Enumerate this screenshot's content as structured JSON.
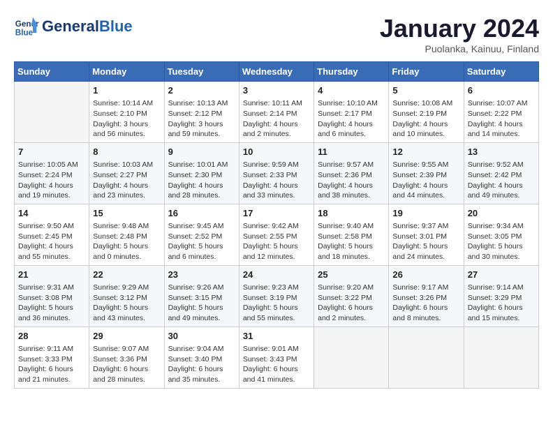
{
  "header": {
    "logo_line1": "General",
    "logo_line2": "Blue",
    "month_title": "January 2024",
    "subtitle": "Puolanka, Kainuu, Finland"
  },
  "weekdays": [
    "Sunday",
    "Monday",
    "Tuesday",
    "Wednesday",
    "Thursday",
    "Friday",
    "Saturday"
  ],
  "weeks": [
    [
      {
        "day": "",
        "info": ""
      },
      {
        "day": "1",
        "info": "Sunrise: 10:14 AM\nSunset: 2:10 PM\nDaylight: 3 hours\nand 56 minutes."
      },
      {
        "day": "2",
        "info": "Sunrise: 10:13 AM\nSunset: 2:12 PM\nDaylight: 3 hours\nand 59 minutes."
      },
      {
        "day": "3",
        "info": "Sunrise: 10:11 AM\nSunset: 2:14 PM\nDaylight: 4 hours\nand 2 minutes."
      },
      {
        "day": "4",
        "info": "Sunrise: 10:10 AM\nSunset: 2:17 PM\nDaylight: 4 hours\nand 6 minutes."
      },
      {
        "day": "5",
        "info": "Sunrise: 10:08 AM\nSunset: 2:19 PM\nDaylight: 4 hours\nand 10 minutes."
      },
      {
        "day": "6",
        "info": "Sunrise: 10:07 AM\nSunset: 2:22 PM\nDaylight: 4 hours\nand 14 minutes."
      }
    ],
    [
      {
        "day": "7",
        "info": "Sunrise: 10:05 AM\nSunset: 2:24 PM\nDaylight: 4 hours\nand 19 minutes."
      },
      {
        "day": "8",
        "info": "Sunrise: 10:03 AM\nSunset: 2:27 PM\nDaylight: 4 hours\nand 23 minutes."
      },
      {
        "day": "9",
        "info": "Sunrise: 10:01 AM\nSunset: 2:30 PM\nDaylight: 4 hours\nand 28 minutes."
      },
      {
        "day": "10",
        "info": "Sunrise: 9:59 AM\nSunset: 2:33 PM\nDaylight: 4 hours\nand 33 minutes."
      },
      {
        "day": "11",
        "info": "Sunrise: 9:57 AM\nSunset: 2:36 PM\nDaylight: 4 hours\nand 38 minutes."
      },
      {
        "day": "12",
        "info": "Sunrise: 9:55 AM\nSunset: 2:39 PM\nDaylight: 4 hours\nand 44 minutes."
      },
      {
        "day": "13",
        "info": "Sunrise: 9:52 AM\nSunset: 2:42 PM\nDaylight: 4 hours\nand 49 minutes."
      }
    ],
    [
      {
        "day": "14",
        "info": "Sunrise: 9:50 AM\nSunset: 2:45 PM\nDaylight: 4 hours\nand 55 minutes."
      },
      {
        "day": "15",
        "info": "Sunrise: 9:48 AM\nSunset: 2:48 PM\nDaylight: 5 hours\nand 0 minutes."
      },
      {
        "day": "16",
        "info": "Sunrise: 9:45 AM\nSunset: 2:52 PM\nDaylight: 5 hours\nand 6 minutes."
      },
      {
        "day": "17",
        "info": "Sunrise: 9:42 AM\nSunset: 2:55 PM\nDaylight: 5 hours\nand 12 minutes."
      },
      {
        "day": "18",
        "info": "Sunrise: 9:40 AM\nSunset: 2:58 PM\nDaylight: 5 hours\nand 18 minutes."
      },
      {
        "day": "19",
        "info": "Sunrise: 9:37 AM\nSunset: 3:01 PM\nDaylight: 5 hours\nand 24 minutes."
      },
      {
        "day": "20",
        "info": "Sunrise: 9:34 AM\nSunset: 3:05 PM\nDaylight: 5 hours\nand 30 minutes."
      }
    ],
    [
      {
        "day": "21",
        "info": "Sunrise: 9:31 AM\nSunset: 3:08 PM\nDaylight: 5 hours\nand 36 minutes."
      },
      {
        "day": "22",
        "info": "Sunrise: 9:29 AM\nSunset: 3:12 PM\nDaylight: 5 hours\nand 43 minutes."
      },
      {
        "day": "23",
        "info": "Sunrise: 9:26 AM\nSunset: 3:15 PM\nDaylight: 5 hours\nand 49 minutes."
      },
      {
        "day": "24",
        "info": "Sunrise: 9:23 AM\nSunset: 3:19 PM\nDaylight: 5 hours\nand 55 minutes."
      },
      {
        "day": "25",
        "info": "Sunrise: 9:20 AM\nSunset: 3:22 PM\nDaylight: 6 hours\nand 2 minutes."
      },
      {
        "day": "26",
        "info": "Sunrise: 9:17 AM\nSunset: 3:26 PM\nDaylight: 6 hours\nand 8 minutes."
      },
      {
        "day": "27",
        "info": "Sunrise: 9:14 AM\nSunset: 3:29 PM\nDaylight: 6 hours\nand 15 minutes."
      }
    ],
    [
      {
        "day": "28",
        "info": "Sunrise: 9:11 AM\nSunset: 3:33 PM\nDaylight: 6 hours\nand 21 minutes."
      },
      {
        "day": "29",
        "info": "Sunrise: 9:07 AM\nSunset: 3:36 PM\nDaylight: 6 hours\nand 28 minutes."
      },
      {
        "day": "30",
        "info": "Sunrise: 9:04 AM\nSunset: 3:40 PM\nDaylight: 6 hours\nand 35 minutes."
      },
      {
        "day": "31",
        "info": "Sunrise: 9:01 AM\nSunset: 3:43 PM\nDaylight: 6 hours\nand 41 minutes."
      },
      {
        "day": "",
        "info": ""
      },
      {
        "day": "",
        "info": ""
      },
      {
        "day": "",
        "info": ""
      }
    ]
  ]
}
